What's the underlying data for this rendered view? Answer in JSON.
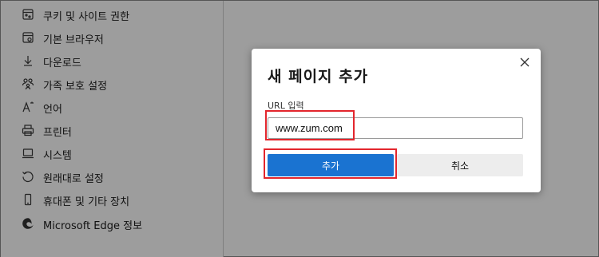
{
  "sidebar": {
    "items": [
      {
        "label": "쿠키 및 사이트 권한",
        "icon": "cookie-permissions-icon"
      },
      {
        "label": "기본 브라우저",
        "icon": "default-browser-icon"
      },
      {
        "label": "다운로드",
        "icon": "download-icon"
      },
      {
        "label": "가족 보호 설정",
        "icon": "family-icon"
      },
      {
        "label": "언어",
        "icon": "language-icon"
      },
      {
        "label": "프린터",
        "icon": "printer-icon"
      },
      {
        "label": "시스템",
        "icon": "system-icon"
      },
      {
        "label": "원래대로 설정",
        "icon": "reset-icon"
      },
      {
        "label": "휴대폰 및 기타 장치",
        "icon": "phone-icon"
      },
      {
        "label": "Microsoft Edge 정보",
        "icon": "edge-logo-icon"
      }
    ]
  },
  "dialog": {
    "title": "새 페이지 추가",
    "url_label": "URL 입력",
    "url_value": "www.zum.com",
    "add_label": "추가",
    "cancel_label": "취소"
  },
  "colors": {
    "accent": "#1a73d1",
    "highlight": "#e3262d",
    "overlay": "#9d9d9d"
  }
}
